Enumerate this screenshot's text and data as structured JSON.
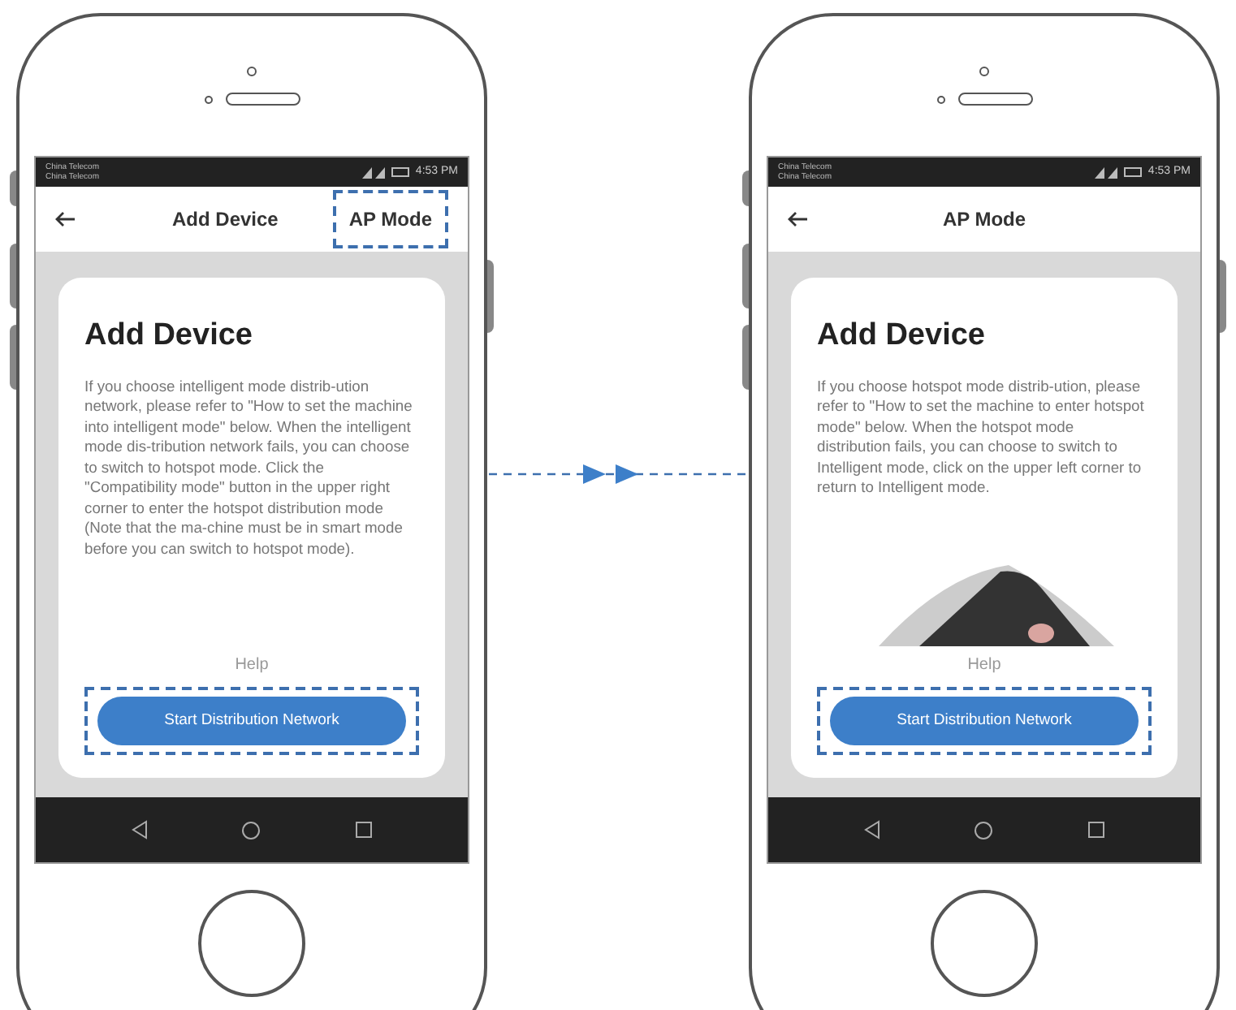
{
  "phones": [
    {
      "status_bar": {
        "carriers": [
          "China Telecom",
          "China Telecom"
        ],
        "time": "4:53 PM"
      },
      "header": {
        "title": "Add Device",
        "action": {
          "label": "AP Mode",
          "highlighted": true
        }
      },
      "card": {
        "title": "Add Device",
        "body": "If you choose intelligent mode distrib-ution network, please refer to \"How to set the machine into intelligent mode\" below. When the intelligent mode dis-tribution network fails, you can choose to switch to hotspot mode. Click the \"Compatibility mode\" button in the upper right corner to enter the hotspot distribution mode (Note that the ma-chine must be in smart mode before you can switch to hotspot mode).",
        "illustration": false,
        "help": "Help",
        "button": {
          "label": "Start Distribution Network",
          "highlighted": true
        }
      }
    },
    {
      "status_bar": {
        "carriers": [
          "China Telecom",
          "China Telecom"
        ],
        "time": "4:53 PM"
      },
      "header": {
        "title": "AP Mode"
      },
      "card": {
        "title": "Add Device",
        "body": "If you choose hotspot mode distrib-ution, please refer to \"How to set the machine to enter hotspot mode\" below. When the hotspot mode distribution fails, you can choose to switch to Intelligent mode, click on the upper left corner to return to Intelligent mode.",
        "illustration": true,
        "help": "Help",
        "button": {
          "label": "Start Distribution Network",
          "highlighted": true
        }
      }
    }
  ]
}
